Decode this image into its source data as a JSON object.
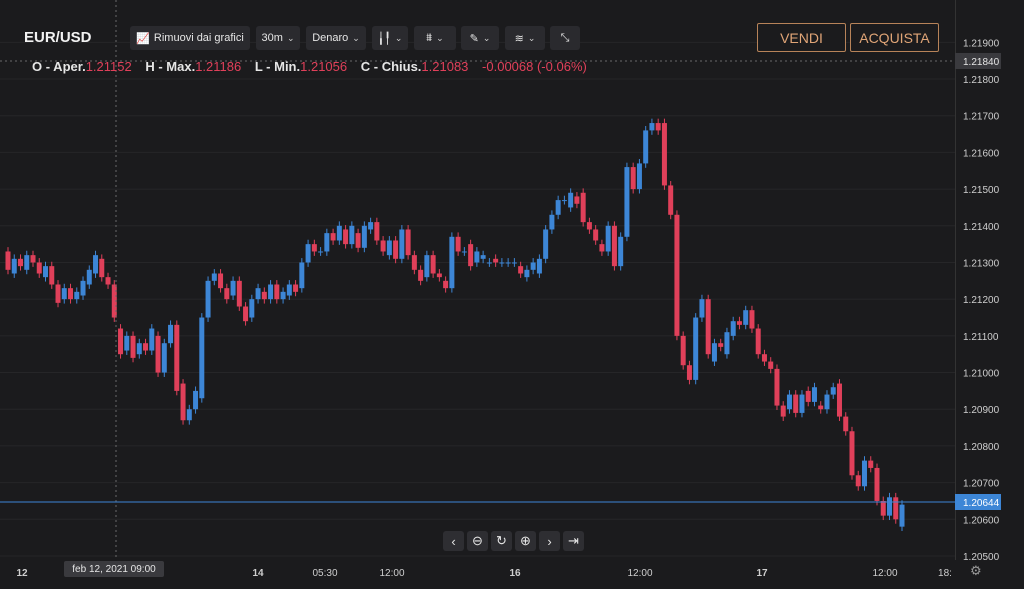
{
  "header": {
    "symbol": "EUR/USD",
    "remove_charts_label": "Rimuovi dai grafici",
    "interval": "30m",
    "price_type": "Denaro",
    "sell_label": "VENDI",
    "buy_label": "ACQUISTA"
  },
  "ohlc": {
    "open_label": "O - Aper.",
    "open": "1.21152",
    "high_label": "H - Max.",
    "high": "1.21186",
    "low_label": "L - Min.",
    "low": "1.21056",
    "close_label": "C - Chius.",
    "close": "1.21083",
    "change": "-0.00068 (-0.06%)"
  },
  "crosshair": {
    "date_label": "feb 12, 2021   09:00"
  },
  "colors": {
    "up": "#3d86d6",
    "down": "#e0405a",
    "background": "#1b1b1d",
    "accent": "#b78359"
  },
  "icons": [
    "chart-line-icon",
    "candlestick-icon",
    "indicator-icon",
    "pencil-icon",
    "layers-icon",
    "collapse-icon",
    "chevron-left-icon",
    "zoom-out-icon",
    "reset-icon",
    "zoom-in-icon",
    "chevron-right-icon",
    "jump-end-icon",
    "settings-gear-icon"
  ],
  "chart_data": {
    "type": "candlestick",
    "ylim": [
      1.205,
      1.2195
    ],
    "y_ticks": [
      "1.21900",
      "1.21800",
      "1.21700",
      "1.21600",
      "1.21500",
      "1.21400",
      "1.21300",
      "1.21200",
      "1.21100",
      "1.21000",
      "1.20900",
      "1.20800",
      "1.20700",
      "1.20600",
      "1.20500"
    ],
    "crosshair_price": "1.21840",
    "last_price": "1.20644",
    "x_ticks": [
      "12",
      "14",
      "05:30",
      "12:00",
      "16",
      "12:00",
      "17",
      "12:00",
      "18:"
    ],
    "candles": [
      [
        1.2133,
        1.2128
      ],
      [
        1.2127,
        1.2131
      ],
      [
        1.2131,
        1.2129
      ],
      [
        1.2128,
        1.2132
      ],
      [
        1.2132,
        1.213
      ],
      [
        1.213,
        1.2127
      ],
      [
        1.2126,
        1.2129
      ],
      [
        1.2129,
        1.2124
      ],
      [
        1.2124,
        1.2119
      ],
      [
        1.212,
        1.2123
      ],
      [
        1.2123,
        1.212
      ],
      [
        1.212,
        1.2122
      ],
      [
        1.2121,
        1.2125
      ],
      [
        1.2124,
        1.2128
      ],
      [
        1.2127,
        1.2132
      ],
      [
        1.2131,
        1.2126
      ],
      [
        1.2126,
        1.2124
      ],
      [
        1.2124,
        1.2115
      ],
      [
        1.2112,
        1.2105
      ],
      [
        1.2106,
        1.211
      ],
      [
        1.211,
        1.2104
      ],
      [
        1.2105,
        1.2108
      ],
      [
        1.2108,
        1.2106
      ],
      [
        1.2106,
        1.2112
      ],
      [
        1.211,
        1.21
      ],
      [
        1.21,
        1.2108
      ],
      [
        1.2108,
        1.2113
      ],
      [
        1.2113,
        1.2095
      ],
      [
        1.2097,
        1.2087
      ],
      [
        1.2087,
        1.209
      ],
      [
        1.209,
        1.2095
      ],
      [
        1.2093,
        1.2115
      ],
      [
        1.2115,
        1.2125
      ],
      [
        1.2125,
        1.2127
      ],
      [
        1.2127,
        1.2123
      ],
      [
        1.2123,
        1.212
      ],
      [
        1.2121,
        1.2125
      ],
      [
        1.2125,
        1.2118
      ],
      [
        1.2118,
        1.2114
      ],
      [
        1.2115,
        1.212
      ],
      [
        1.212,
        1.2123
      ],
      [
        1.2122,
        1.212
      ],
      [
        1.212,
        1.2124
      ],
      [
        1.2124,
        1.212
      ],
      [
        1.212,
        1.2122
      ],
      [
        1.2121,
        1.2124
      ],
      [
        1.2124,
        1.2122
      ],
      [
        1.2123,
        1.213
      ],
      [
        1.213,
        1.2135
      ],
      [
        1.2135,
        1.2133
      ],
      [
        1.2133,
        1.2133
      ],
      [
        1.2133,
        1.2138
      ],
      [
        1.2138,
        1.2136
      ],
      [
        1.2136,
        1.214
      ],
      [
        1.2139,
        1.2135
      ],
      [
        1.2135,
        1.214
      ],
      [
        1.2138,
        1.2134
      ],
      [
        1.2134,
        1.214
      ],
      [
        1.2139,
        1.2141
      ],
      [
        1.2141,
        1.2136
      ],
      [
        1.2136,
        1.2133
      ],
      [
        1.2132,
        1.2136
      ],
      [
        1.2136,
        1.2131
      ],
      [
        1.2131,
        1.2139
      ],
      [
        1.2139,
        1.2132
      ],
      [
        1.2132,
        1.2128
      ],
      [
        1.2128,
        1.2125
      ],
      [
        1.2126,
        1.2132
      ],
      [
        1.2132,
        1.2127
      ],
      [
        1.2127,
        1.2126
      ],
      [
        1.2125,
        1.2123
      ],
      [
        1.2123,
        1.2137
      ],
      [
        1.2137,
        1.2133
      ],
      [
        1.2133,
        1.2133
      ],
      [
        1.2135,
        1.2129
      ],
      [
        1.213,
        1.2133
      ],
      [
        1.2131,
        1.2132
      ],
      [
        1.213,
        1.213
      ],
      [
        1.2131,
        1.213
      ],
      [
        1.213,
        1.213
      ],
      [
        1.213,
        1.213
      ],
      [
        1.213,
        1.213
      ],
      [
        1.2129,
        1.2127
      ],
      [
        1.2126,
        1.2128
      ],
      [
        1.2128,
        1.213
      ],
      [
        1.2127,
        1.2131
      ],
      [
        1.2131,
        1.2139
      ],
      [
        1.2139,
        1.2143
      ],
      [
        1.2143,
        1.2147
      ],
      [
        1.2147,
        1.2147
      ],
      [
        1.2145,
        1.2149
      ],
      [
        1.2148,
        1.2146
      ],
      [
        1.2149,
        1.2141
      ],
      [
        1.2141,
        1.2139
      ],
      [
        1.2139,
        1.2136
      ],
      [
        1.2135,
        1.2133
      ],
      [
        1.2133,
        1.214
      ],
      [
        1.214,
        1.2129
      ],
      [
        1.2129,
        1.2137
      ],
      [
        1.2137,
        1.2156
      ],
      [
        1.2156,
        1.215
      ],
      [
        1.215,
        1.2157
      ],
      [
        1.2157,
        1.2166
      ],
      [
        1.2166,
        1.2168
      ],
      [
        1.2168,
        1.2166
      ],
      [
        1.2168,
        1.2151
      ],
      [
        1.2151,
        1.2143
      ],
      [
        1.2143,
        1.211
      ],
      [
        1.211,
        1.2102
      ],
      [
        1.2102,
        1.2098
      ],
      [
        1.2098,
        1.2115
      ],
      [
        1.2115,
        1.212
      ],
      [
        1.212,
        1.2105
      ],
      [
        1.2103,
        1.2108
      ],
      [
        1.2108,
        1.2107
      ],
      [
        1.2105,
        1.2111
      ],
      [
        1.211,
        1.2114
      ],
      [
        1.2114,
        1.2113
      ],
      [
        1.2113,
        1.2117
      ],
      [
        1.2117,
        1.2112
      ],
      [
        1.2112,
        1.2105
      ],
      [
        1.2105,
        1.2103
      ],
      [
        1.2103,
        1.2101
      ],
      [
        1.2101,
        1.2091
      ],
      [
        1.2091,
        1.2088
      ],
      [
        1.209,
        1.2094
      ],
      [
        1.2094,
        1.2089
      ],
      [
        1.2089,
        1.2094
      ],
      [
        1.2095,
        1.2092
      ],
      [
        1.2092,
        1.2096
      ],
      [
        1.2091,
        1.209
      ],
      [
        1.209,
        1.2094
      ],
      [
        1.2094,
        1.2096
      ],
      [
        1.2097,
        1.2088
      ],
      [
        1.2088,
        1.2084
      ],
      [
        1.2084,
        1.2072
      ],
      [
        1.2072,
        1.2069
      ],
      [
        1.2069,
        1.2076
      ],
      [
        1.2076,
        1.2074
      ],
      [
        1.2074,
        1.2065
      ],
      [
        1.2065,
        1.2061
      ],
      [
        1.2061,
        1.2066
      ],
      [
        1.2066,
        1.206
      ],
      [
        1.2058,
        1.2064
      ]
    ]
  }
}
